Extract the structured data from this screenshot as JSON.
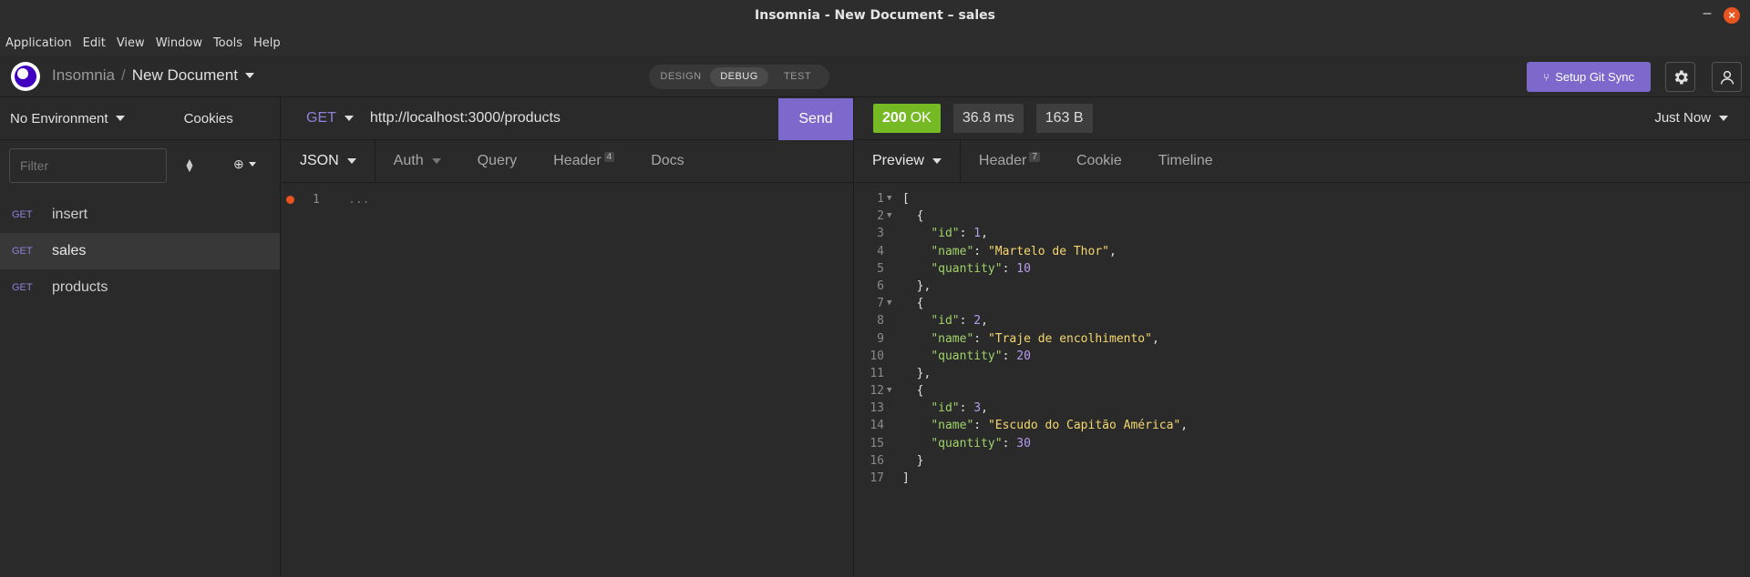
{
  "window": {
    "title": "Insomnia - New Document – sales"
  },
  "menu": [
    "Application",
    "Edit",
    "View",
    "Window",
    "Tools",
    "Help"
  ],
  "header": {
    "app_name": "Insomnia",
    "separator": "/",
    "document": "New Document",
    "modes": [
      "DESIGN",
      "DEBUG",
      "TEST"
    ],
    "active_mode": "DEBUG",
    "git_sync_label": "Setup Git Sync"
  },
  "sidebar": {
    "environment": "No Environment",
    "cookies": "Cookies",
    "filter_placeholder": "Filter",
    "requests": [
      {
        "method": "GET",
        "name": "insert",
        "active": false
      },
      {
        "method": "GET",
        "name": "sales",
        "active": true
      },
      {
        "method": "GET",
        "name": "products",
        "active": false
      }
    ]
  },
  "request": {
    "method": "GET",
    "url": "http://localhost:3000/products",
    "send_label": "Send",
    "tabs": [
      {
        "label": "JSON"
      },
      {
        "label": "Auth"
      },
      {
        "label": "Query"
      },
      {
        "label": "Header",
        "badge": "4"
      },
      {
        "label": "Docs"
      }
    ],
    "editor_line_number": "1",
    "editor_placeholder": "..."
  },
  "response": {
    "status_code": "200",
    "status_text": "OK",
    "time": "36.8 ms",
    "size": "163 B",
    "history": "Just Now",
    "tabs": [
      {
        "label": "Preview"
      },
      {
        "label": "Header",
        "badge": "7"
      },
      {
        "label": "Cookie"
      },
      {
        "label": "Timeline"
      }
    ]
  },
  "accent_colors": {
    "brand": "#7d69cb",
    "status_ok": "#75ba24",
    "close": "#e95420"
  }
}
